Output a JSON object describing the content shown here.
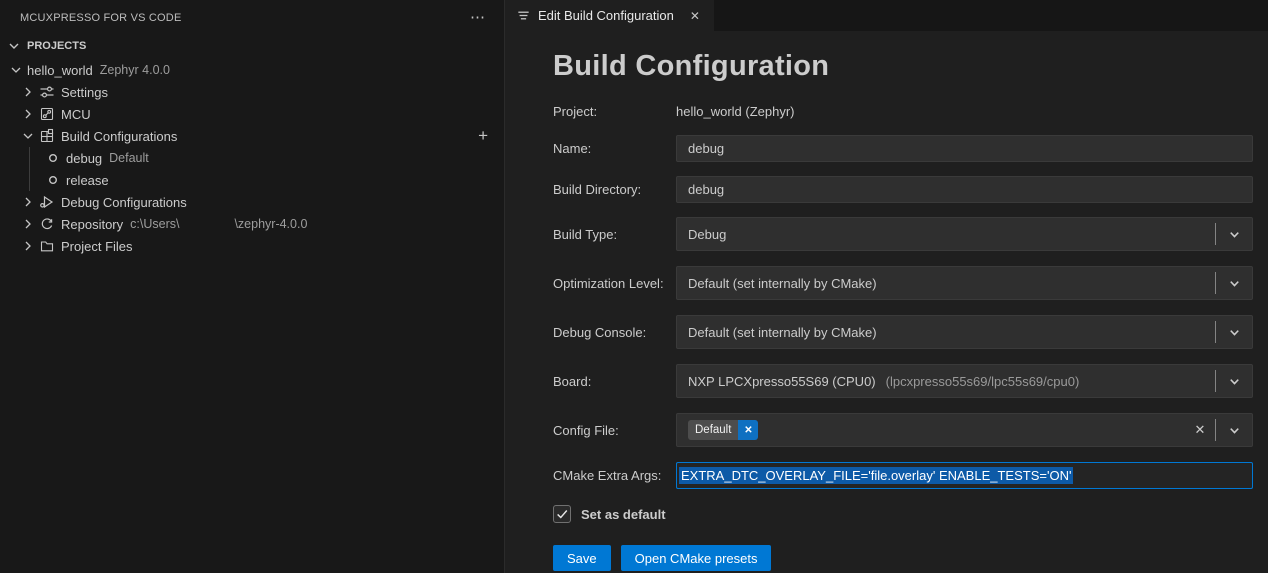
{
  "sidebar": {
    "title": "MCUXPRESSO FOR VS CODE",
    "section": "PROJECTS",
    "tree": [
      {
        "label": "hello_world",
        "desc": "Zephyr 4.0.0",
        "expanded": true
      },
      {
        "label": "Settings",
        "icon": "settings-sliders-icon"
      },
      {
        "label": "MCU",
        "icon": "circuit-board-icon"
      },
      {
        "label": "Build Configurations",
        "icon": "build-grid-icon",
        "expanded": true,
        "action": "add"
      },
      {
        "label": "debug",
        "desc": "Default",
        "icon": "circle-icon"
      },
      {
        "label": "release",
        "icon": "circle-icon"
      },
      {
        "label": "Debug Configurations",
        "icon": "debug-run-icon"
      },
      {
        "label": "Repository",
        "desc": "c:\\Users\\",
        "desc2": "\\zephyr-4.0.0",
        "icon": "repository-icon"
      },
      {
        "label": "Project Files",
        "icon": "folder-icon"
      }
    ]
  },
  "editor": {
    "tab": {
      "label": "Edit Build Configuration"
    },
    "heading": "Build Configuration",
    "form": {
      "project_label": "Project:",
      "project_value": "hello_world (Zephyr)",
      "name_label": "Name:",
      "name_value": "debug",
      "build_dir_label": "Build Directory:",
      "build_dir_value": "debug",
      "build_type_label": "Build Type:",
      "build_type_value": "Debug",
      "opt_label": "Optimization Level:",
      "opt_value": "Default (set internally by CMake)",
      "console_label": "Debug Console:",
      "console_value": "Default (set internally by CMake)",
      "board_label": "Board:",
      "board_value": "NXP LPCXpresso55S69 (CPU0)",
      "board_detail": "(lpcxpresso55s69/lpc55s69/cpu0)",
      "config_label": "Config File:",
      "config_chip": "Default",
      "cmake_label": "CMake Extra Args:",
      "cmake_value": "EXTRA_DTC_OVERLAY_FILE='file.overlay' ENABLE_TESTS='ON'",
      "set_default_label": "Set as default",
      "set_default_checked": true,
      "save_label": "Save",
      "presets_label": "Open CMake presets"
    }
  },
  "icons": {
    "more": "⋯",
    "plus": "+",
    "close": "✕",
    "clear": "✕",
    "chip_remove": "✕"
  },
  "colors": {
    "accent": "#0078d4",
    "selection": "#0d5aa7",
    "focus_border": "#0078d4",
    "sidebar_bg": "#181818",
    "editor_bg": "#1f1f1f",
    "input_bg": "#2f2f2f",
    "chip_bg": "#4d4d4d",
    "text": "#cccccc",
    "desc_text": "#9d9d9d"
  }
}
